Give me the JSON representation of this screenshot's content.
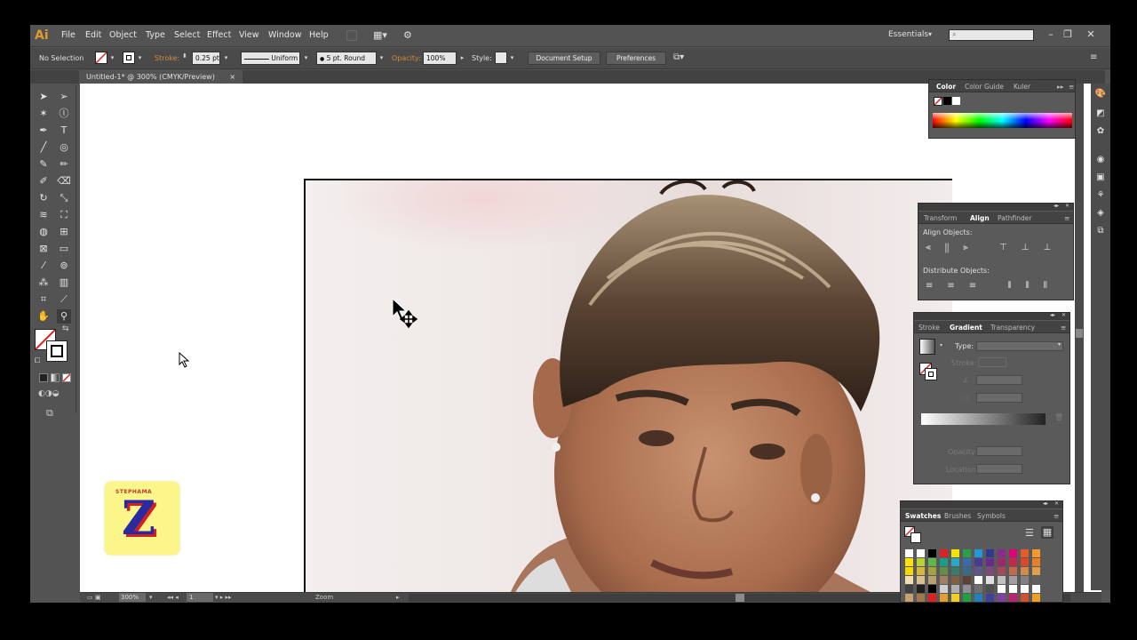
{
  "app": {
    "logo": "Ai",
    "workspace": "Essentials"
  },
  "menu": [
    "File",
    "Edit",
    "Object",
    "Type",
    "Select",
    "Effect",
    "View",
    "Window",
    "Help"
  ],
  "control_bar": {
    "selection": "No Selection",
    "stroke_label": "Stroke:",
    "stroke_weight": "0.25 pt",
    "stroke_profile": "Uniform",
    "brush": "5 pt. Round",
    "opacity_label": "Opacity:",
    "opacity": "100%",
    "style_label": "Style:",
    "document_setup": "Document Setup",
    "preferences": "Preferences"
  },
  "document_tab": {
    "title": "Untitled-1* @ 300% (CMYK/Preview)",
    "close": "×"
  },
  "status_bar": {
    "zoom": "300%",
    "page": "1",
    "tool": "Zoom"
  },
  "color_panel": {
    "tabs": [
      "Color",
      "Color Guide",
      "Kuler"
    ]
  },
  "align_panel": {
    "tabs": [
      "Transform",
      "Align",
      "Pathfinder"
    ],
    "align_objects": "Align Objects:",
    "distribute_objects": "Distribute Objects:"
  },
  "gradient_panel": {
    "tabs": [
      "Stroke",
      "Gradient",
      "Transparency"
    ],
    "type_label": "Type:",
    "stroke_label": "Stroke:",
    "opacity_label": "Opacity:",
    "location_label": "Location:"
  },
  "swatches_panel": {
    "tabs": [
      "Swatches",
      "Brushes",
      "Symbols"
    ]
  },
  "logo_overlay": {
    "top_text": "STEPHAMA",
    "letter": "Z"
  },
  "colors": {
    "accent": "#e09a2e",
    "ui_bg": "#535353",
    "panel_bg": "#5a5a5a",
    "logo_bg": "#fbf58a",
    "logo_letter": "#2a2aa0",
    "logo_letter_shadow": "#d02020"
  }
}
